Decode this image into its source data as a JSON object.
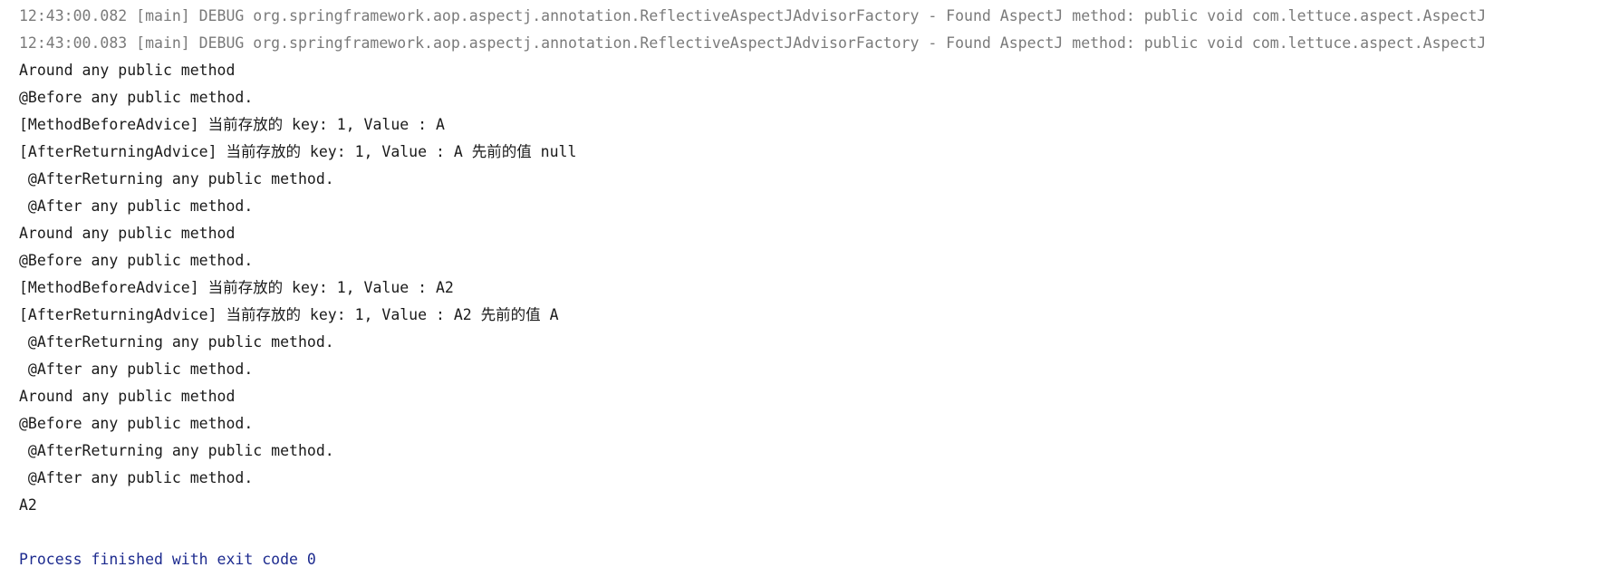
{
  "console": {
    "lines": [
      {
        "text": "12:43:00.082 [main] DEBUG org.springframework.aop.aspectj.annotation.ReflectiveAspectJAdvisorFactory - Found AspectJ method: public void com.lettuce.aspect.AspectJ",
        "style": "debug"
      },
      {
        "text": "12:43:00.083 [main] DEBUG org.springframework.aop.aspectj.annotation.ReflectiveAspectJAdvisorFactory - Found AspectJ method: public void com.lettuce.aspect.AspectJ",
        "style": "debug"
      },
      {
        "text": "Around any public method",
        "style": "normal"
      },
      {
        "text": "@Before any public method.",
        "style": "normal"
      },
      {
        "text": "[MethodBeforeAdvice] 当前存放的 key: 1, Value : A",
        "style": "normal"
      },
      {
        "text": "[AfterReturningAdvice] 当前存放的 key: 1, Value : A 先前的值 null",
        "style": "normal"
      },
      {
        "text": " @AfterReturning any public method.",
        "style": "normal"
      },
      {
        "text": " @After any public method.",
        "style": "normal"
      },
      {
        "text": "Around any public method",
        "style": "normal"
      },
      {
        "text": "@Before any public method.",
        "style": "normal"
      },
      {
        "text": "[MethodBeforeAdvice] 当前存放的 key: 1, Value : A2",
        "style": "normal"
      },
      {
        "text": "[AfterReturningAdvice] 当前存放的 key: 1, Value : A2 先前的值 A",
        "style": "normal"
      },
      {
        "text": " @AfterReturning any public method.",
        "style": "normal"
      },
      {
        "text": " @After any public method.",
        "style": "normal"
      },
      {
        "text": "Around any public method",
        "style": "normal"
      },
      {
        "text": "@Before any public method.",
        "style": "normal"
      },
      {
        "text": " @AfterReturning any public method.",
        "style": "normal"
      },
      {
        "text": " @After any public method.",
        "style": "normal"
      },
      {
        "text": "A2",
        "style": "normal"
      },
      {
        "text": "",
        "style": "normal"
      },
      {
        "text": "Process finished with exit code 0",
        "style": "process"
      }
    ]
  }
}
